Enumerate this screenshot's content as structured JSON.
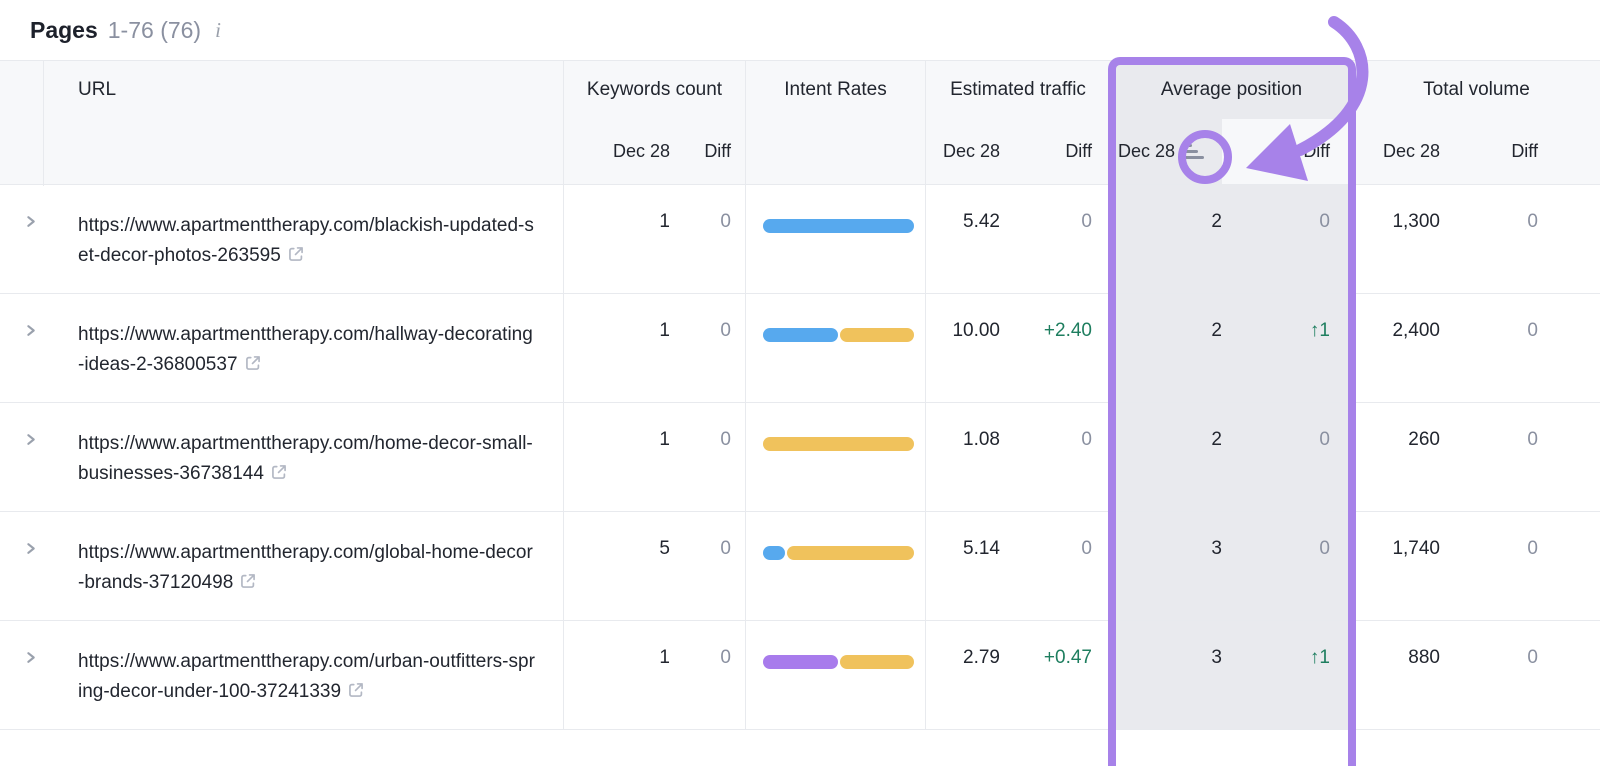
{
  "colors": {
    "annotation": "#a782e9",
    "green": "#1e7e5f",
    "gray-text": "#8a90a0",
    "dark-text": "#22262f",
    "blue": "#57a9ee",
    "yellow": "#f0c25c",
    "purple": "#a87bec",
    "header-bg": "#f7f8fa",
    "sorted-bg": "#e9eaee",
    "border": "#e8eaee"
  },
  "header": {
    "title": "Pages",
    "range": "1-76 (76)",
    "info_icon": "i"
  },
  "table": {
    "columns": {
      "url": "URL",
      "keywords": "Keywords count",
      "intent": "Intent Rates",
      "traffic": "Estimated traffic",
      "position": "Average position",
      "volume": "Total volume",
      "date": "Dec 28",
      "diff": "Diff"
    },
    "sorted_column": "Average position",
    "rows": [
      {
        "url": "https://www.apartmenttherapy.com/blackish-updated-set-decor-photos-263595",
        "keywords": "1",
        "keywords_diff": {
          "text": "0",
          "type": "neutral"
        },
        "intent_segments": [
          {
            "color": "blue",
            "pct": 100
          }
        ],
        "traffic": "5.42",
        "traffic_diff": {
          "text": "0",
          "type": "neutral"
        },
        "position": "2",
        "position_diff": {
          "text": "0",
          "type": "neutral"
        },
        "volume": "1,300",
        "volume_diff": {
          "text": "0",
          "type": "neutral"
        }
      },
      {
        "url": "https://www.apartmenttherapy.com/hallway-decorating-ideas-2-36800537",
        "keywords": "1",
        "keywords_diff": {
          "text": "0",
          "type": "neutral"
        },
        "intent_segments": [
          {
            "color": "blue",
            "pct": 50
          },
          {
            "color": "yellow",
            "pct": 50
          }
        ],
        "traffic": "10.00",
        "traffic_diff": {
          "text": "+2.40",
          "type": "up"
        },
        "position": "2",
        "position_diff": {
          "text": "↑1",
          "type": "up"
        },
        "volume": "2,400",
        "volume_diff": {
          "text": "0",
          "type": "neutral"
        }
      },
      {
        "url": "https://www.apartmenttherapy.com/home-decor-small-businesses-36738144",
        "keywords": "1",
        "keywords_diff": {
          "text": "0",
          "type": "neutral"
        },
        "intent_segments": [
          {
            "color": "yellow",
            "pct": 100
          }
        ],
        "traffic": "1.08",
        "traffic_diff": {
          "text": "0",
          "type": "neutral"
        },
        "position": "2",
        "position_diff": {
          "text": "0",
          "type": "neutral"
        },
        "volume": "260",
        "volume_diff": {
          "text": "0",
          "type": "neutral"
        }
      },
      {
        "url": "https://www.apartmenttherapy.com/global-home-decor-brands-37120498",
        "keywords": "5",
        "keywords_diff": {
          "text": "0",
          "type": "neutral"
        },
        "intent_segments": [
          {
            "color": "blue",
            "pct": 15
          },
          {
            "color": "yellow",
            "pct": 85
          }
        ],
        "traffic": "5.14",
        "traffic_diff": {
          "text": "0",
          "type": "neutral"
        },
        "position": "3",
        "position_diff": {
          "text": "0",
          "type": "neutral"
        },
        "volume": "1,740",
        "volume_diff": {
          "text": "0",
          "type": "neutral"
        }
      },
      {
        "url": "https://www.apartmenttherapy.com/urban-outfitters-spring-decor-under-100-37241339",
        "keywords": "1",
        "keywords_diff": {
          "text": "0",
          "type": "neutral"
        },
        "intent_segments": [
          {
            "color": "purple",
            "pct": 50
          },
          {
            "color": "yellow",
            "pct": 50
          }
        ],
        "traffic": "2.79",
        "traffic_diff": {
          "text": "+0.47",
          "type": "up"
        },
        "position": "3",
        "position_diff": {
          "text": "↑1",
          "type": "up"
        },
        "volume": "880",
        "volume_diff": {
          "text": "0",
          "type": "neutral"
        }
      }
    ]
  }
}
